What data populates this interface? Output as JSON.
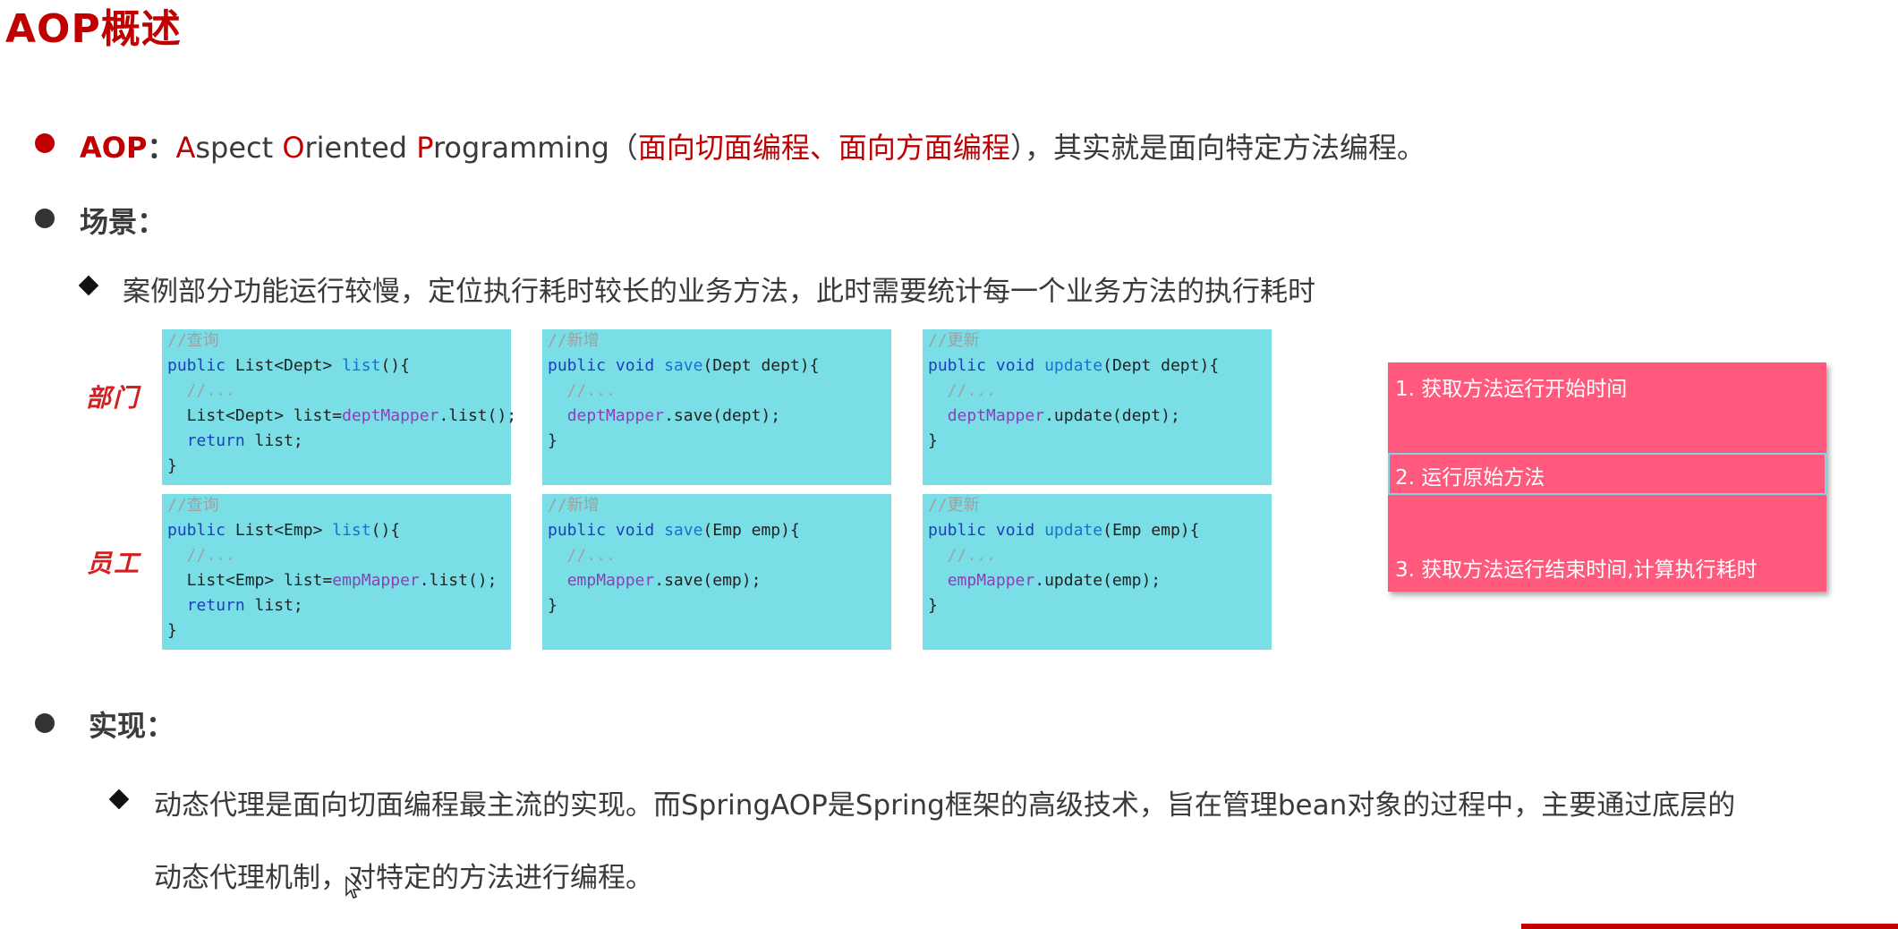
{
  "title": "AOP概述",
  "bullets": {
    "aop": {
      "term": "AOP",
      "colon": "：",
      "A": "A",
      "spect": "spect ",
      "O": "O",
      "riented": "riented ",
      "P": "P",
      "rogramming": "rogramming",
      "paren_open": "（",
      "cn_terms": "面向切面编程、面向方面编程",
      "paren_close": "）",
      "rest": "，其实就是面向特定方法编程。"
    },
    "scene": {
      "heading": "场景：",
      "item": "案例部分功能运行较慢，定位执行耗时较长的业务方法，此时需要统计每一个业务方法的执行耗时"
    },
    "impl": {
      "heading": "实现：",
      "line1": "动态代理是面向切面编程最主流的实现。而SpringAOP是Spring框架的高级技术，旨在管理bean对象的过程中，主要通过底层的",
      "line2": "动态代理机制，对特定的方法进行编程。"
    }
  },
  "row_labels": {
    "dept": "部门",
    "emp": "员工"
  },
  "code": {
    "dept_list": [
      "//查询",
      "public List<Dept> list(){",
      "  //...",
      "  List<Dept> list=deptMapper.list();",
      "  return list;",
      "}"
    ],
    "dept_save": [
      "//新增",
      "public void save(Dept dept){",
      "  //...",
      "  deptMapper.save(dept);",
      "}"
    ],
    "dept_update": [
      "//更新",
      "public void update(Dept dept){",
      "  //...",
      "  deptMapper.update(dept);",
      "}"
    ],
    "emp_list": [
      "//查询",
      "public List<Emp> list(){",
      "  //...",
      "  List<Emp> list=empMapper.list();",
      "  return list;",
      "}"
    ],
    "emp_save": [
      "//新增",
      "public void save(Emp emp){",
      "  //...",
      "  empMapper.save(emp);",
      "}"
    ],
    "emp_update": [
      "//更新",
      "public void update(Emp emp){",
      "  //...",
      "  empMapper.update(emp);",
      "}"
    ]
  },
  "steps": {
    "s1": "1. 获取方法运行开始时间",
    "s2": "2. 运行原始方法",
    "s3": "3. 获取方法运行结束时间,计算执行耗时"
  },
  "colors": {
    "accent": "#c00000",
    "code_bg": "#7adee6",
    "steps_bg": "#ff5a7e"
  }
}
